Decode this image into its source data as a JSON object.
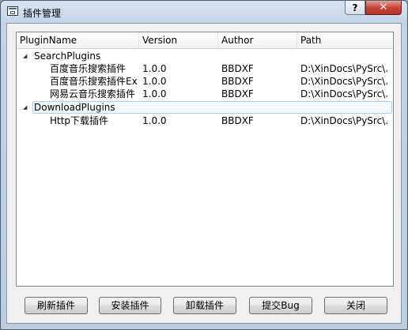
{
  "window": {
    "title": "插件管理",
    "help_label": "?",
    "close_label": "✕"
  },
  "tree": {
    "columns": [
      "PluginName",
      "Version",
      "Author",
      "Path"
    ],
    "groups": [
      {
        "name": "SearchPlugins",
        "items": [
          {
            "name": "百度音乐搜索插件",
            "version": "1.0.0",
            "author": "BBDXF",
            "path": "D:\\XinDocs\\PySrc\\..."
          },
          {
            "name": "百度音乐搜索插件Ex",
            "version": "1.0.0",
            "author": "BBDXF",
            "path": "D:\\XinDocs\\PySrc\\..."
          },
          {
            "name": "网易云音乐搜索插件",
            "version": "1.0.0",
            "author": "BBDXF",
            "path": "D:\\XinDocs\\PySrc\\..."
          }
        ]
      },
      {
        "name": "DownloadPlugins",
        "items": [
          {
            "name": "Http下载插件",
            "version": "1.0.0",
            "author": "BBDXF",
            "path": "D:\\XinDocs\\PySrc\\..."
          }
        ]
      }
    ]
  },
  "buttons": {
    "refresh": "刷新插件",
    "install": "安装插件",
    "uninstall": "卸载插件",
    "submit_bug": "提交Bug",
    "close": "关闭"
  }
}
